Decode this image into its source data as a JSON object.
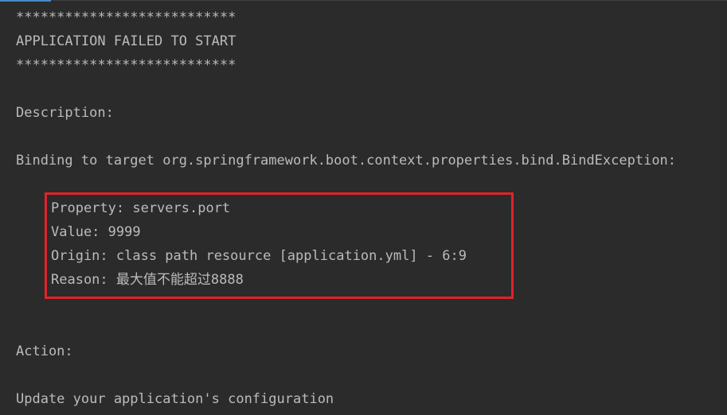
{
  "console": {
    "banner_top": "***************************",
    "title": "APPLICATION FAILED TO START",
    "banner_bottom": "***************************",
    "description_header": "Description:",
    "binding_line": "Binding to target org.springframework.boot.context.properties.bind.BindException:",
    "details": {
      "property": "Property: servers.port",
      "value": "Value: 9999",
      "origin": "Origin: class path resource [application.yml] - 6:9",
      "reason": "Reason: 最大值不能超过8888"
    },
    "action_header": "Action:",
    "action_text": "Update your application's configuration"
  },
  "colors": {
    "background": "#2b2b2b",
    "text": "#bbbbbb",
    "highlight_border": "#e0232b",
    "accent": "#4a88c7"
  }
}
